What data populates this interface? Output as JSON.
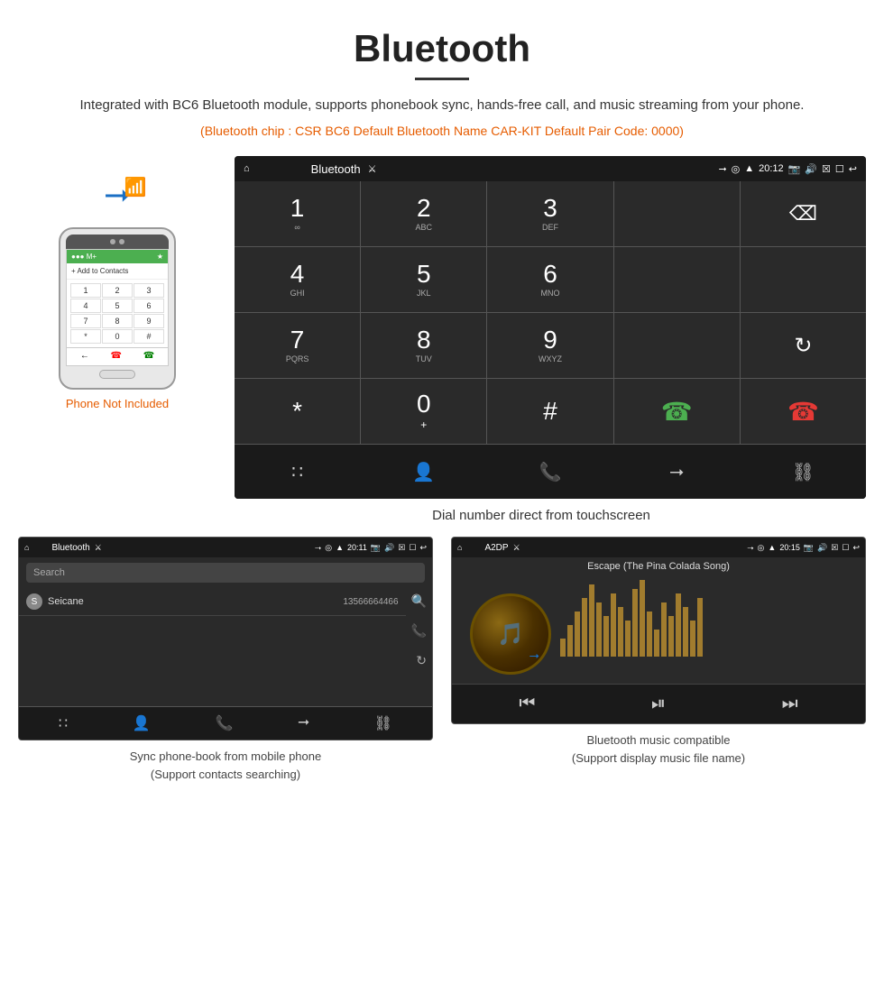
{
  "header": {
    "title": "Bluetooth",
    "underline": true,
    "subtitle": "Integrated with BC6 Bluetooth module, supports phonebook sync, hands-free call, and music streaming from your phone.",
    "info_line": "(Bluetooth chip : CSR BC6    Default Bluetooth Name CAR-KIT    Default Pair Code: 0000)"
  },
  "phone_not_included": "Phone Not Included",
  "dial_screen": {
    "title": "Bluetooth",
    "status_time": "20:12",
    "status_icons": [
      "bluetooth",
      "location",
      "signal",
      "usb"
    ],
    "keys": [
      {
        "num": "1",
        "sub": "∞",
        "row": 0,
        "col": 0
      },
      {
        "num": "2",
        "sub": "ABC",
        "row": 0,
        "col": 1
      },
      {
        "num": "3",
        "sub": "DEF",
        "row": 0,
        "col": 2
      },
      {
        "num": "4",
        "sub": "GHI",
        "row": 1,
        "col": 0
      },
      {
        "num": "5",
        "sub": "JKL",
        "row": 1,
        "col": 1
      },
      {
        "num": "6",
        "sub": "MNO",
        "row": 1,
        "col": 2
      },
      {
        "num": "7",
        "sub": "PQRS",
        "row": 2,
        "col": 0
      },
      {
        "num": "8",
        "sub": "TUV",
        "row": 2,
        "col": 1
      },
      {
        "num": "9",
        "sub": "WXYZ",
        "row": 2,
        "col": 2
      },
      {
        "num": "*",
        "sub": "",
        "row": 3,
        "col": 0
      },
      {
        "num": "0",
        "sub": "+",
        "row": 3,
        "col": 1
      },
      {
        "num": "#",
        "sub": "",
        "row": 3,
        "col": 2
      }
    ]
  },
  "dial_caption": "Dial number direct from touchscreen",
  "phonebook_screen": {
    "title": "Bluetooth",
    "status_time": "20:11",
    "search_placeholder": "Search",
    "contacts": [
      {
        "letter": "S",
        "name": "Seicane",
        "phone": "13566664466"
      }
    ]
  },
  "music_screen": {
    "title": "A2DP",
    "status_time": "20:15",
    "song_title": "Escape (The Pina Colada Song)",
    "visualizer_bars": [
      20,
      35,
      50,
      65,
      80,
      60,
      45,
      70,
      55,
      40,
      75,
      85,
      50,
      30,
      60,
      45,
      70,
      55,
      40,
      65
    ]
  },
  "phonebook_caption_line1": "Sync phone-book from mobile phone",
  "phonebook_caption_line2": "(Support contacts searching)",
  "music_caption_line1": "Bluetooth music compatible",
  "music_caption_line2": "(Support display music file name)"
}
